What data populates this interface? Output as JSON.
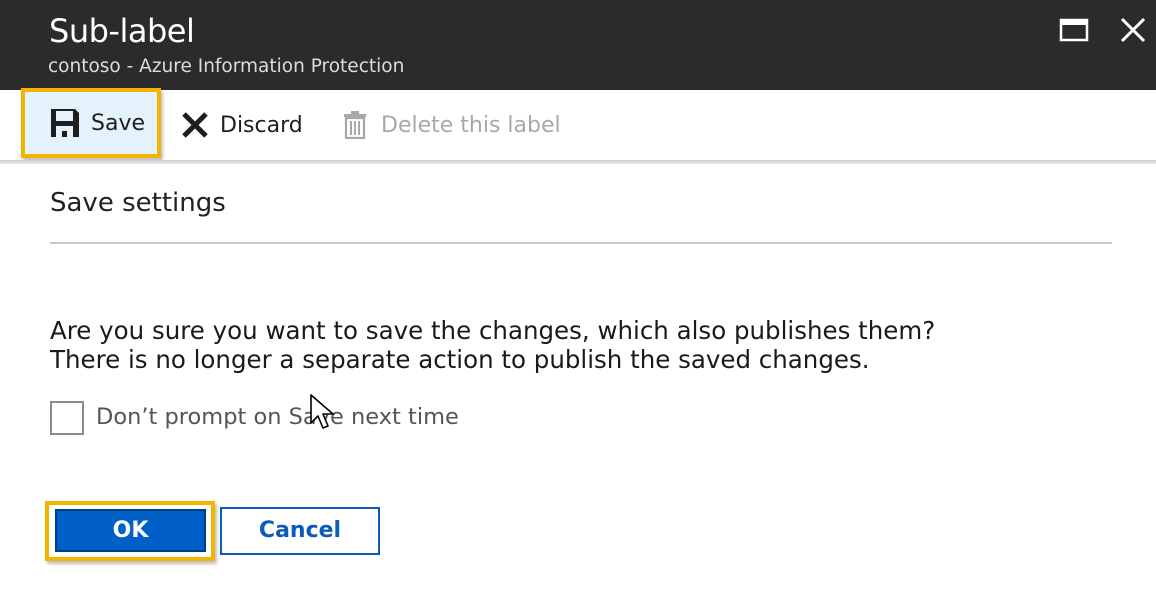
{
  "window": {
    "title": "Sub-label",
    "subtitle": "contoso - Azure Information Protection",
    "controls": [
      "maximize-icon",
      "close-icon"
    ]
  },
  "commandbar": {
    "save_label": "Save",
    "discard_label": "Discard",
    "delete_label": "Delete this label",
    "save_icon": "floppy-disk-icon",
    "discard_icon": "x-icon",
    "delete_icon": "trash-icon"
  },
  "dialog": {
    "title": "Save settings",
    "message_line1": "Are you sure you want to save the changes, which also publishes them?",
    "message_line2": "There is no longer a separate action to publish the saved changes.",
    "checkbox_label": "Don’t prompt on Save next time",
    "checkbox_checked": false,
    "ok_label": "OK",
    "cancel_label": "Cancel"
  },
  "colors": {
    "titlebar": "#2b2b2b",
    "highlight": "#f5b400",
    "primary_button": "#0060c8",
    "link_blue": "#0a5cb8"
  }
}
